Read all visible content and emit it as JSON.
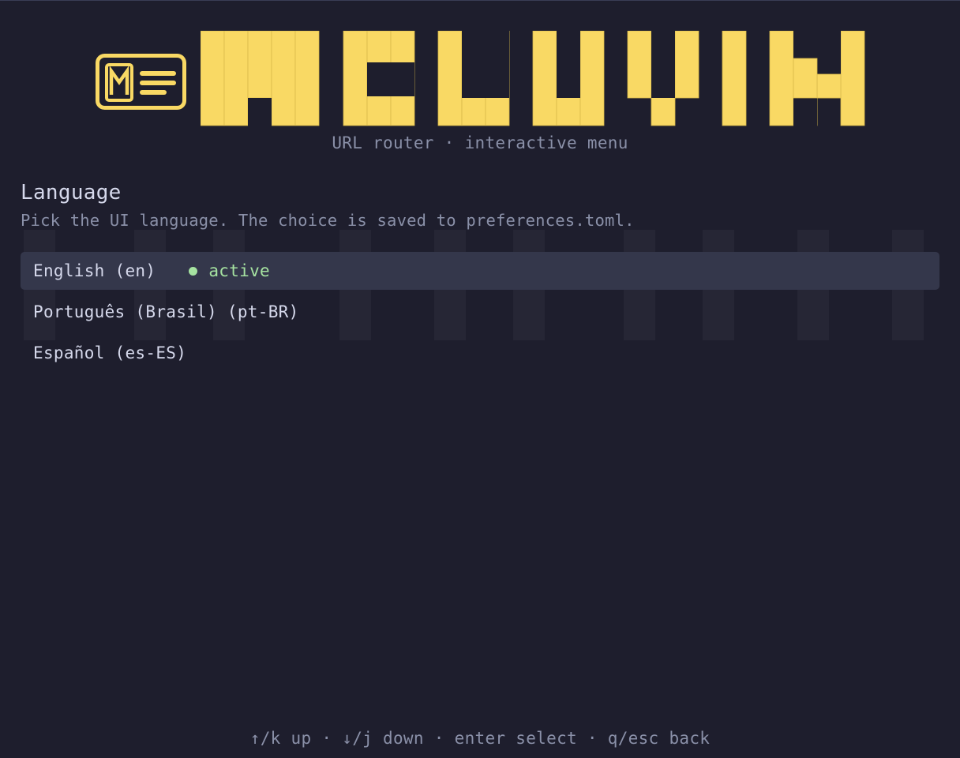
{
  "app": {
    "logo_icon": "id-card-m-icon",
    "wordmark": "MCLOVIN",
    "subtitle": "URL router · interactive menu",
    "accent_color": "#f9d964"
  },
  "section": {
    "title": "Language",
    "description": "Pick the UI language. The choice is saved to preferences.toml."
  },
  "languages": [
    {
      "label": "English (en)",
      "active_label": "active",
      "selected": true
    },
    {
      "label": "Português (Brasil) (pt-BR)"
    },
    {
      "label": "Español (es-ES)"
    }
  ],
  "footer": {
    "hints": "↑/k up · ↓/j down · enter select · q/esc back"
  },
  "colors": {
    "background": "#1e1e2d",
    "selection": "#34374b",
    "active": "#a6e3a1",
    "muted_text": "#8a90a8",
    "text": "#d6d9ec"
  }
}
